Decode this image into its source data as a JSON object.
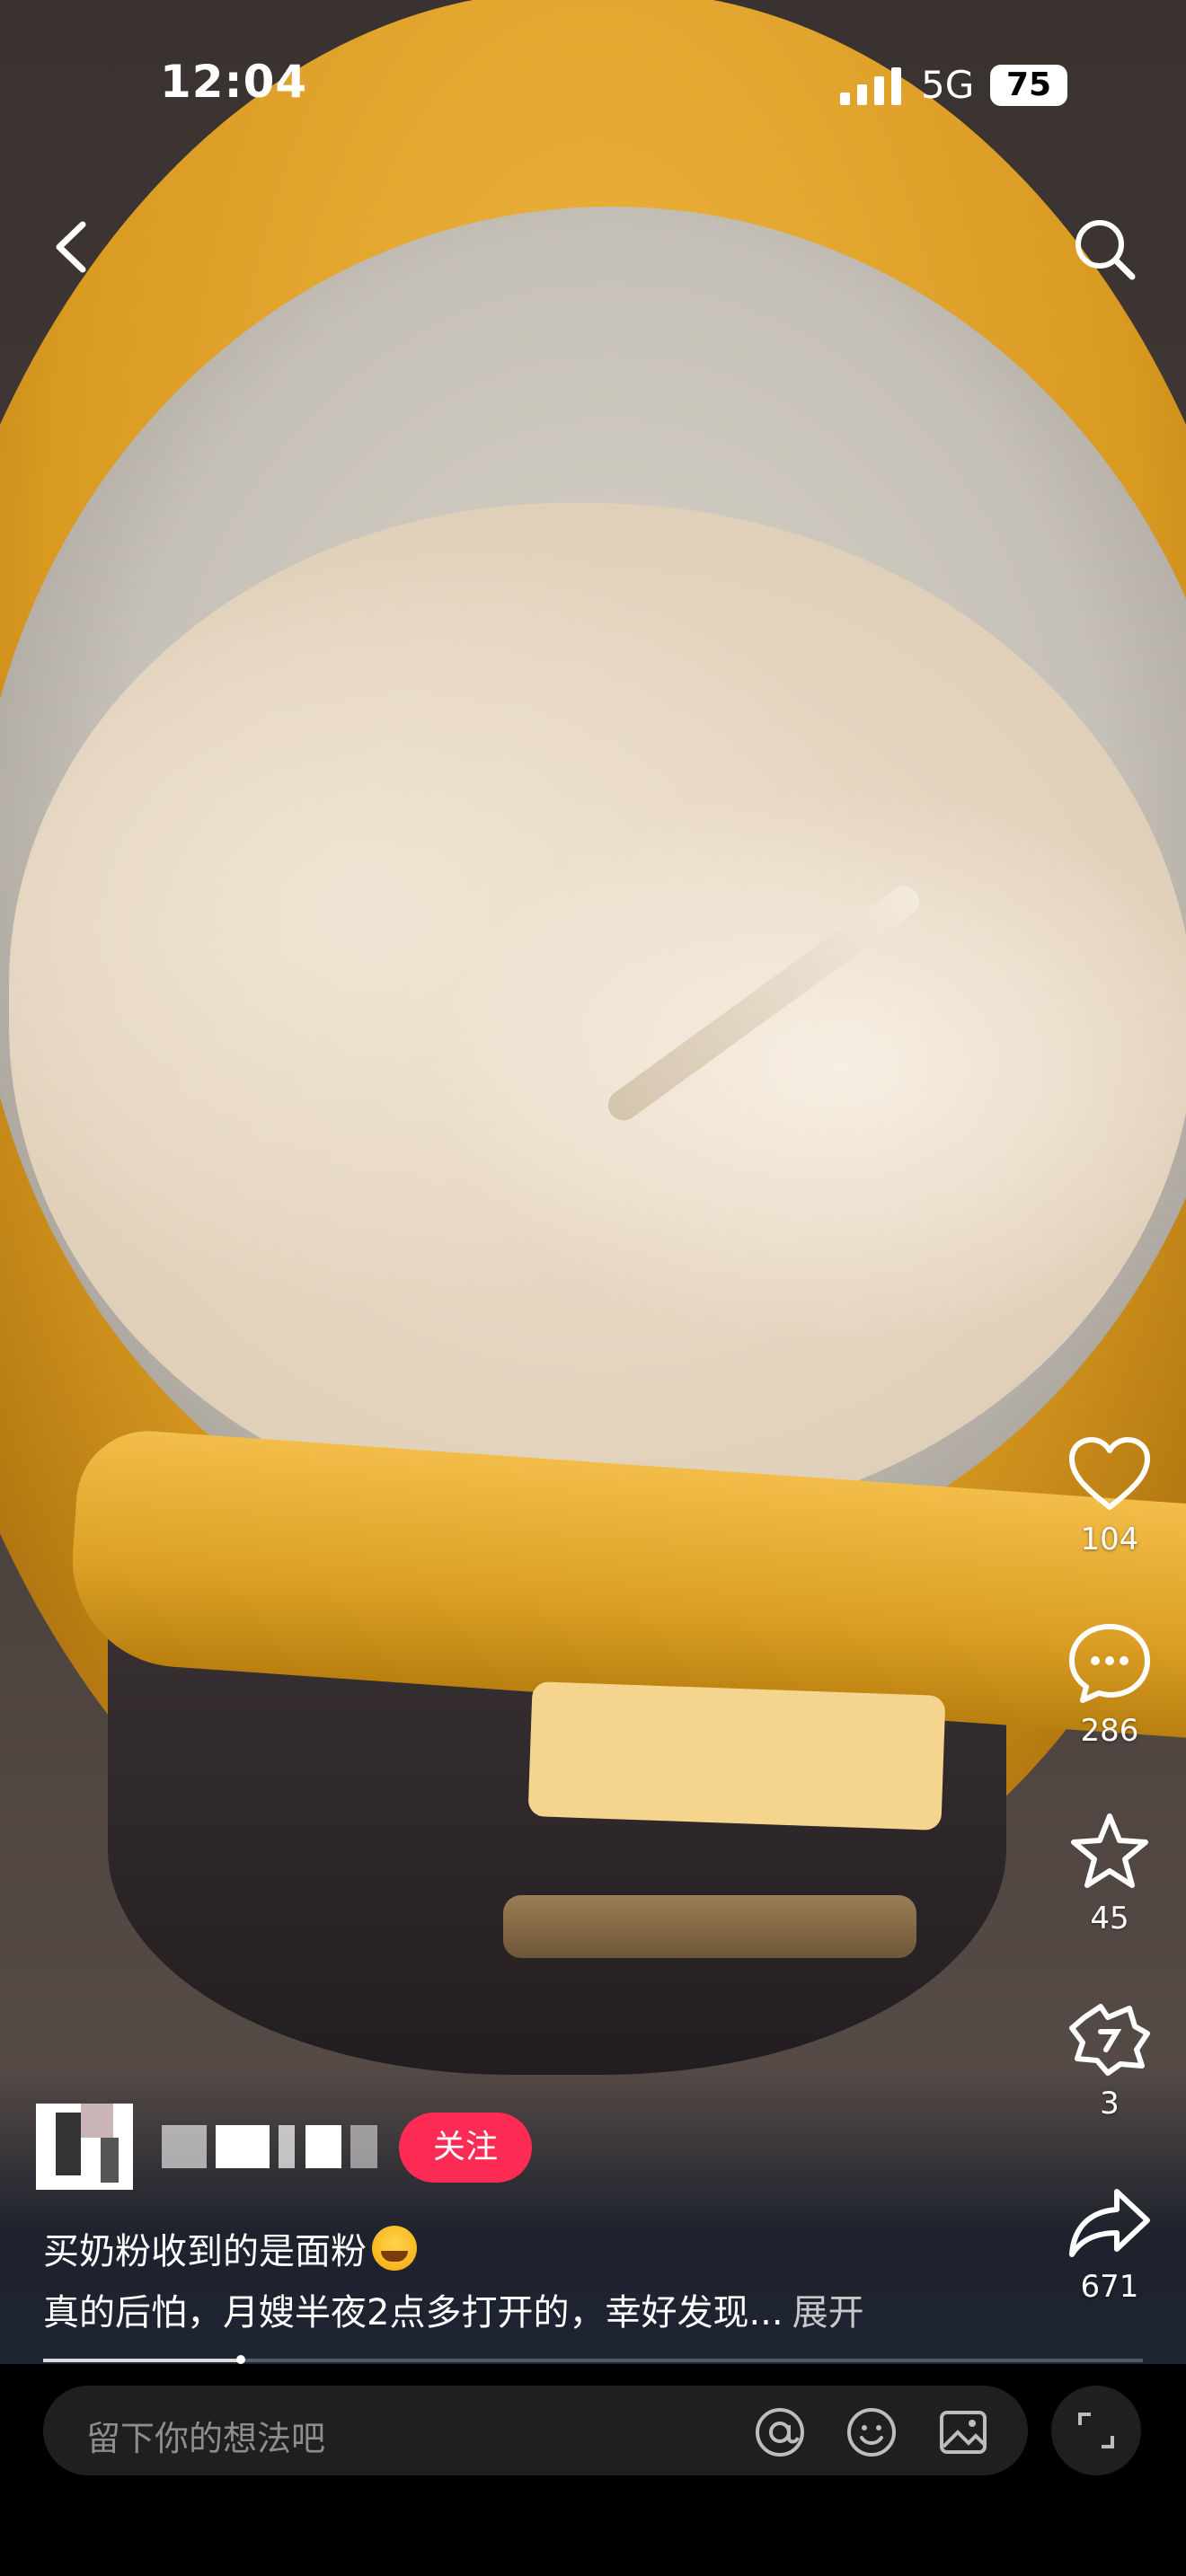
{
  "status_bar": {
    "time": "12:04",
    "network": "5G",
    "battery": "75"
  },
  "post": {
    "follow_label": "关注",
    "caption_title": "买奶粉收到的是面粉",
    "caption_body": "真的后怕，月嫂半夜2点多打开的，幸好发现...",
    "expand_label": "展开",
    "progress_fraction": 0.18
  },
  "actions": {
    "likes": "104",
    "comments": "286",
    "favorites": "45",
    "shares_wechat": "3",
    "shares": "671"
  },
  "comment_bar": {
    "placeholder": "留下你的想法吧"
  },
  "icons": [
    "back-icon",
    "search-icon",
    "heart-icon",
    "comment-icon",
    "star-icon",
    "repost-icon",
    "share-icon",
    "at-icon",
    "emoji-icon",
    "image-icon",
    "fullscreen-icon"
  ],
  "colors": {
    "follow": "#fe2c55",
    "background": "#000000"
  }
}
